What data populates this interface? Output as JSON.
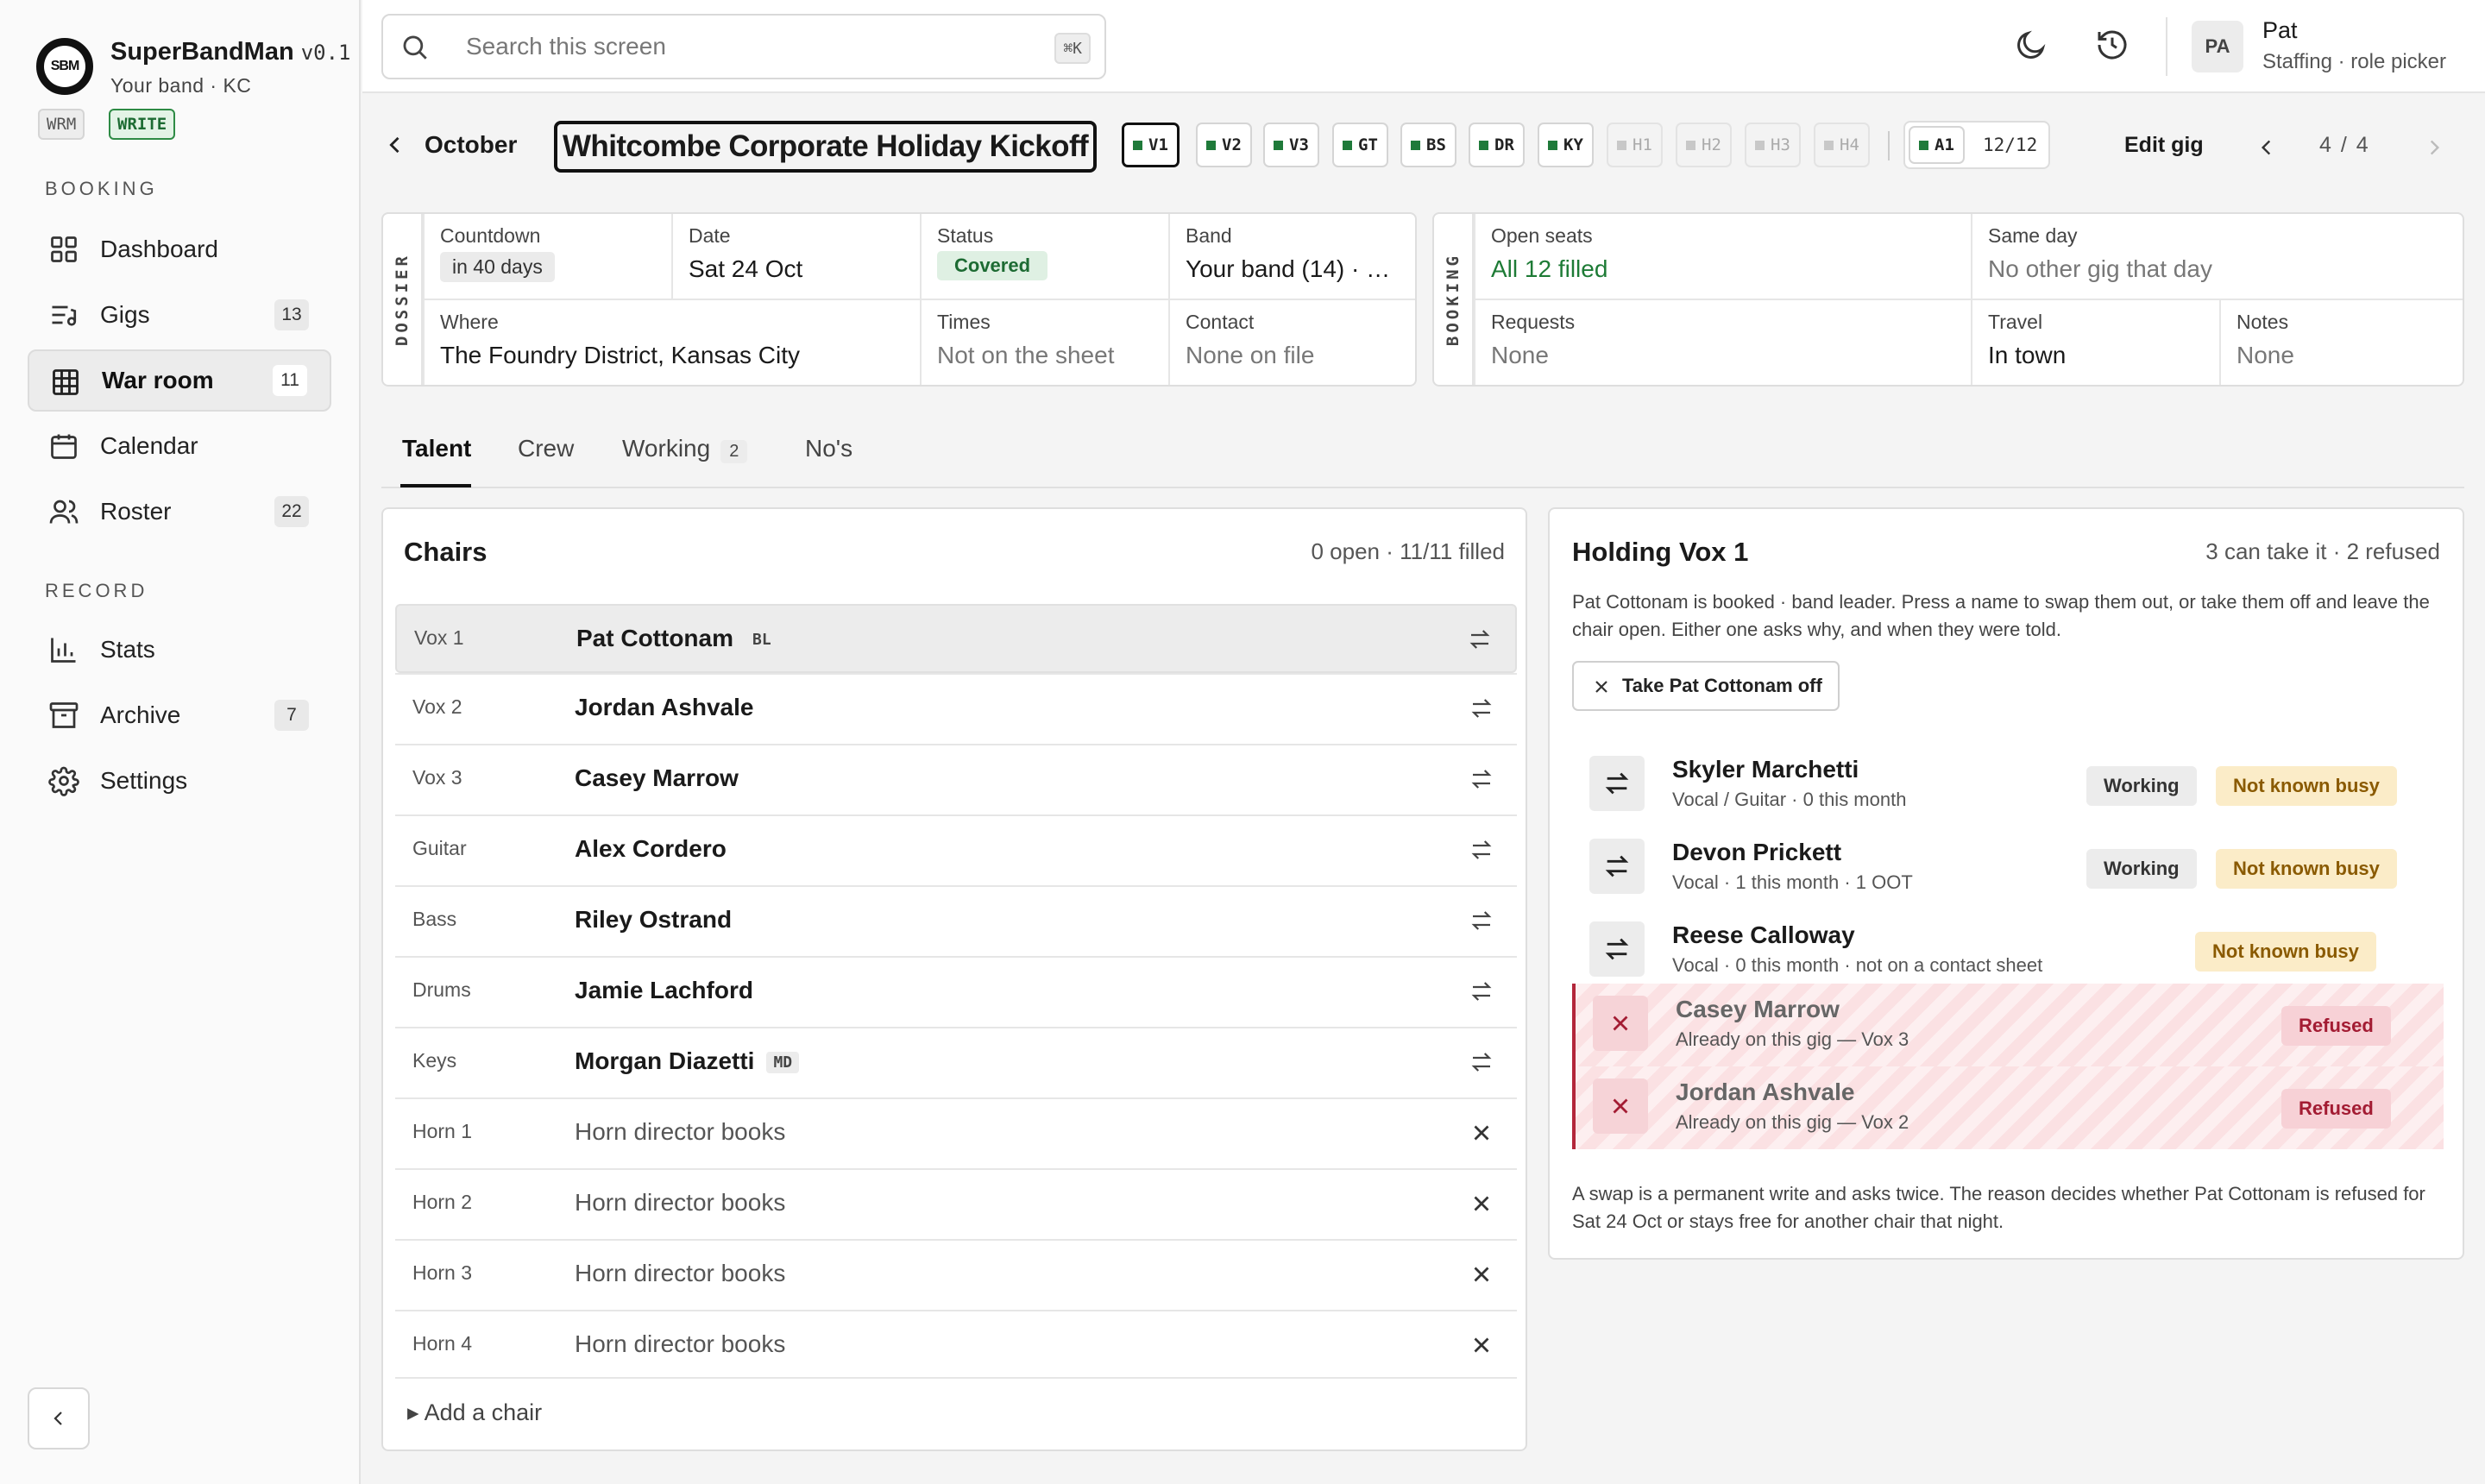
{
  "app": {
    "name": "SuperBandMan",
    "version": "v0.1",
    "subtitle": "Your band · KC",
    "logo_text": "SBM",
    "tag_wrm": "WRM",
    "tag_write": "WRITE"
  },
  "sidebar": {
    "section_booking": "BOOKING",
    "section_record": "RECORD",
    "items": [
      {
        "label": "Dashboard",
        "icon": "dashboard-icon"
      },
      {
        "label": "Gigs",
        "count": "13",
        "icon": "gigs-icon"
      },
      {
        "label": "War room",
        "count": "11",
        "icon": "grid-icon",
        "active": true
      },
      {
        "label": "Calendar",
        "icon": "calendar-icon"
      },
      {
        "label": "Roster",
        "count": "22",
        "icon": "users-icon"
      },
      {
        "label": "Stats",
        "icon": "bar-chart-icon"
      },
      {
        "label": "Archive",
        "count": "7",
        "icon": "archive-icon"
      },
      {
        "label": "Settings",
        "icon": "gear-icon"
      }
    ]
  },
  "topbar": {
    "search_placeholder": "Search this screen",
    "shortcut": "⌘K",
    "user_initials": "PA",
    "user_name": "Pat",
    "user_role": "Staffing · role picker"
  },
  "gig": {
    "back_label": "October",
    "title": "Whitcombe Corporate Holiday Kickoff",
    "chips": [
      "V1",
      "V2",
      "V3",
      "GT",
      "BS",
      "DR",
      "KY",
      "H1",
      "H2",
      "H3",
      "H4"
    ],
    "extra_chip": "A1",
    "chip_count": "12/12",
    "edit_label": "Edit gig",
    "pager": "4 / 4"
  },
  "dossier": {
    "label": "DOSSIER",
    "countdown_k": "Countdown",
    "countdown_v": "in 40 days",
    "date_k": "Date",
    "date_v": "Sat 24 Oct",
    "status_k": "Status",
    "status_v": "Covered",
    "band_k": "Band",
    "band_v": "Your band (14) · …",
    "where_k": "Where",
    "where_v": "The Foundry District, Kansas City",
    "times_k": "Times",
    "times_v": "Not on the sheet",
    "contact_k": "Contact",
    "contact_v": "None on file"
  },
  "booking": {
    "label": "BOOKING",
    "open_k": "Open seats",
    "open_v": "All 12 filled",
    "same_k": "Same day",
    "same_v": "No other gig that day",
    "req_k": "Requests",
    "req_v": "None",
    "travel_k": "Travel",
    "travel_v": "In town",
    "notes_k": "Notes",
    "notes_v": "None"
  },
  "tabs": {
    "talent": "Talent",
    "crew": "Crew",
    "working": "Working",
    "working_count": "2",
    "nos": "No's"
  },
  "chairs": {
    "title": "Chairs",
    "meta": "0 open · 11/11 filled",
    "rows": [
      {
        "pos": "Vox 1",
        "name": "Pat Cottonam",
        "tag": "BL"
      },
      {
        "pos": "Vox 2",
        "name": "Jordan Ashvale"
      },
      {
        "pos": "Vox 3",
        "name": "Casey Marrow"
      },
      {
        "pos": "Guitar",
        "name": "Alex Cordero"
      },
      {
        "pos": "Bass",
        "name": "Riley Ostrand"
      },
      {
        "pos": "Drums",
        "name": "Jamie Lachford"
      },
      {
        "pos": "Keys",
        "name": "Morgan Diazetti",
        "tag": "MD"
      },
      {
        "pos": "Horn 1",
        "name": "Horn director books"
      },
      {
        "pos": "Horn 2",
        "name": "Horn director books"
      },
      {
        "pos": "Horn 3",
        "name": "Horn director books"
      },
      {
        "pos": "Horn 4",
        "name": "Horn director books"
      }
    ],
    "add_label": "▸ Add a chair"
  },
  "holding": {
    "title": "Holding Vox 1",
    "meta": "3 can take it · 2 refused",
    "desc": "Pat Cottonam is booked · band leader. Press a name to swap them out, or take them off and leave the chair open. Either one asks why, and when they were told.",
    "takeoff_label": "Take Pat Cottonam off",
    "candidates": [
      {
        "name": "Skyler Marchetti",
        "sub": "Vocal / Guitar · 0 this month",
        "s1": "Working",
        "s2": "Not known busy"
      },
      {
        "name": "Devon Prickett",
        "sub": "Vocal · 1 this month · 1 OOT",
        "s1": "Working",
        "s2": "Not known busy"
      },
      {
        "name": "Reese Calloway",
        "sub": "Vocal · 0 this month · not on a contact sheet",
        "s2": "Not known busy"
      },
      {
        "name": "Casey Marrow",
        "sub": "Already on this gig — Vox 3",
        "s2": "Refused"
      },
      {
        "name": "Jordan Ashvale",
        "sub": "Already on this gig — Vox 2",
        "s2": "Refused"
      }
    ],
    "footer": "A swap is a permanent write and asks twice. The reason decides whether Pat Cottonam is refused for Sat 24 Oct or stays free for another chair that night."
  },
  "colors": {
    "accent_green": "#1f7a3a",
    "refused_red": "#a31c33",
    "busy_amber": "#8a5a00"
  }
}
